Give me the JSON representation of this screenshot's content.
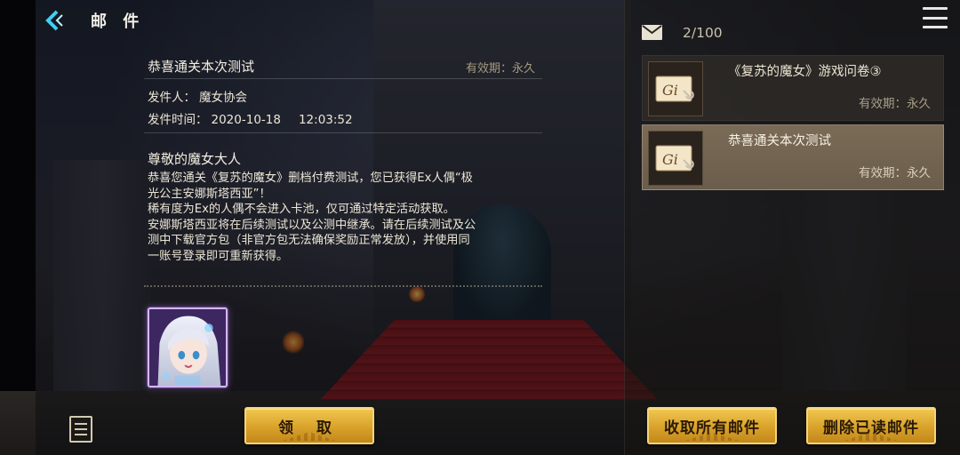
{
  "header": {
    "title": "邮 件"
  },
  "detail": {
    "subject": "恭喜通关本次测试",
    "validity": "有效期：永久",
    "sender_label": "发件人：",
    "sender": "魔女协会",
    "time_label": "发件时间：",
    "date": "2020-10-18",
    "time": "12:03:52",
    "greeting": "尊敬的魔女大人",
    "body": [
      "恭喜您通关《复苏的魔女》删档付费测试，您已获得Ex人偶“极",
      "光公主安娜斯塔西亚”！",
      "稀有度为Ex的人偶不会进入卡池，仅可通过特定活动获取。",
      "安娜斯塔西亚将在后续测试以及公测中继承。请在后续测试及公",
      "测中下载官方包（非官方包无法确保奖励正常发放），并使用同",
      "一账号登录即可重新获得。"
    ],
    "claim_label": "领 取"
  },
  "inbox": {
    "count": "2/100",
    "items": [
      {
        "title": "《复苏的魔女》游戏问卷③",
        "validity": "有效期：永久",
        "selected": false
      },
      {
        "title": "恭喜通关本次测试",
        "validity": "有效期：永久",
        "selected": true
      }
    ],
    "collect_all_label": "收取所有邮件",
    "delete_read_label": "删除已读邮件"
  },
  "icons": {
    "back": "back-chevron-icon",
    "menu": "hamburger-menu-icon",
    "mail": "envelope-icon",
    "notes": "notes-icon",
    "mail_item": "sealed-letter-icon"
  },
  "colors": {
    "accent_gold": "#e0aa33",
    "selected_item": "#75664f",
    "back_arrow": "#3fd0f2"
  }
}
